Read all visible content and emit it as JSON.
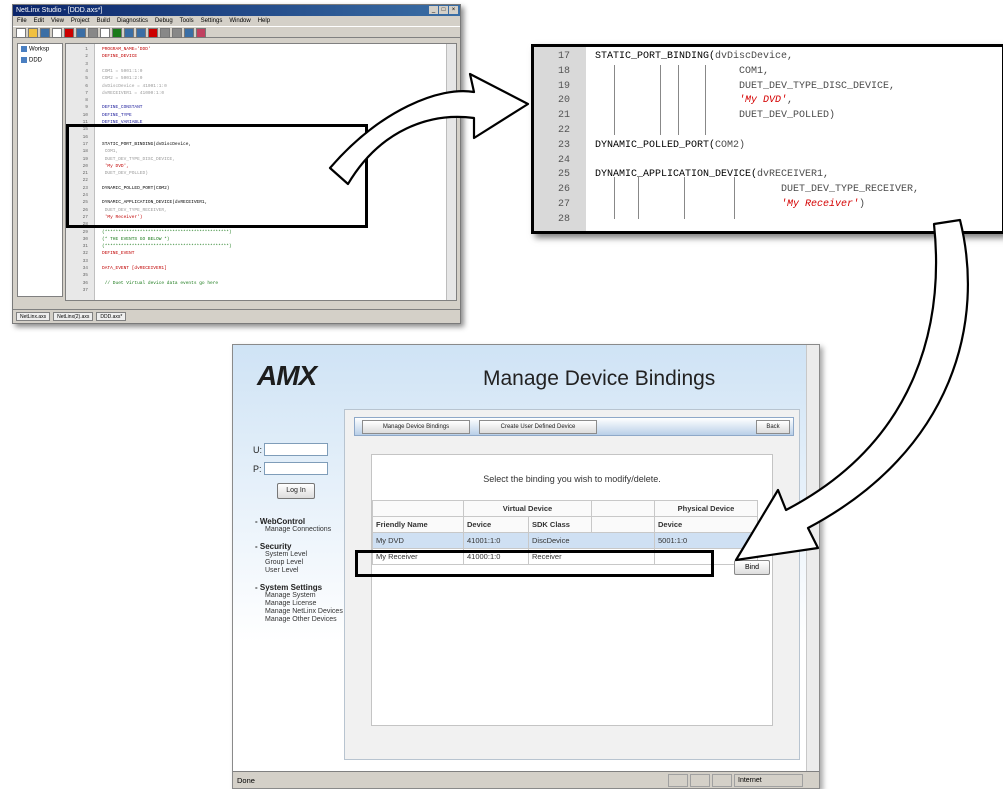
{
  "studio": {
    "title": "NetLinx Studio - [DDD.axs*]",
    "menu": [
      "File",
      "Edit",
      "View",
      "Project",
      "Build",
      "Diagnostics",
      "Debug",
      "Tools",
      "Settings",
      "Window",
      "Help"
    ],
    "tree": [
      "Worksp",
      "DDD"
    ],
    "tabs": [
      "NetLinx.axs",
      "NetLinx(2).axs",
      "DDD.axs*"
    ],
    "code": [
      {
        "n": "1",
        "t": "PROGRAM_NAME='DDD'",
        "c": "#c00000"
      },
      {
        "n": "2",
        "t": "DEFINE_DEVICE",
        "c": "#c00000"
      },
      {
        "n": "3",
        "t": "",
        "c": "#000"
      },
      {
        "n": "4",
        "t": "COM1 = 5001:1:0",
        "c": "#9a9a9a"
      },
      {
        "n": "5",
        "t": "COM2 = 5001:2:0",
        "c": "#9a9a9a"
      },
      {
        "n": "6",
        "t": "dvDiscDevice = 41001:1:0",
        "c": "#9a9a9a"
      },
      {
        "n": "7",
        "t": "dvRECEIVER1 = 41000:1:0",
        "c": "#9a9a9a"
      },
      {
        "n": "8",
        "t": "",
        "c": "#000"
      },
      {
        "n": "9",
        "t": "DEFINE_CONSTANT",
        "c": "#1a1a9a"
      },
      {
        "n": "10",
        "t": "DEFINE_TYPE",
        "c": "#1a1a9a"
      },
      {
        "n": "11",
        "t": "DEFINE_VARIABLE",
        "c": "#1a1a9a"
      },
      {
        "n": "15",
        "t": "",
        "c": "#000"
      },
      {
        "n": "16",
        "t": "",
        "c": "#000"
      },
      {
        "n": "17",
        "t": "STATIC_PORT_BINDING(dvDiscDevice,",
        "c": "#000"
      },
      {
        "n": "18",
        "t": "                 COM1,",
        "c": "#9a9a9a"
      },
      {
        "n": "19",
        "t": "                 DUET_DEV_TYPE_DISC_DEVICE,",
        "c": "#9a9a9a"
      },
      {
        "n": "20",
        "t": "                 'My DVD',",
        "c": "#c00000"
      },
      {
        "n": "21",
        "t": "                 DUET_DEV_POLLED)",
        "c": "#9a9a9a"
      },
      {
        "n": "22",
        "t": "",
        "c": "#000"
      },
      {
        "n": "23",
        "t": "DYNAMIC_POLLED_PORT(COM2)",
        "c": "#000"
      },
      {
        "n": "24",
        "t": "",
        "c": "#000"
      },
      {
        "n": "25",
        "t": "DYNAMIC_APPLICATION_DEVICE(dvRECEIVER1,",
        "c": "#000"
      },
      {
        "n": "26",
        "t": "                       DUET_DEV_TYPE_RECEIVER,",
        "c": "#9a9a9a"
      },
      {
        "n": "27",
        "t": "                       'My Receiver')",
        "c": "#c00000"
      },
      {
        "n": "28",
        "t": "",
        "c": "#000"
      },
      {
        "n": "29",
        "t": "(**********************************************)",
        "c": "#1a7a1a"
      },
      {
        "n": "30",
        "t": "(*           THE EVENTS GO BELOW             *)",
        "c": "#1a7a1a"
      },
      {
        "n": "31",
        "t": "(**********************************************)",
        "c": "#1a7a1a"
      },
      {
        "n": "32",
        "t": "DEFINE_EVENT",
        "c": "#c00000"
      },
      {
        "n": "33",
        "t": "",
        "c": "#000"
      },
      {
        "n": "34",
        "t": "DATA_EVENT [dvRECEIVER1]",
        "c": "#c00000"
      },
      {
        "n": "35",
        "t": "",
        "c": "#000"
      },
      {
        "n": "36",
        "t": "     // Duet Virtual device data events go here",
        "c": "#1a7a1a"
      },
      {
        "n": "37",
        "t": "",
        "c": "#000"
      }
    ]
  },
  "zoom": {
    "lines": [
      {
        "n": "17",
        "t": "STATIC_PORT_BINDING(",
        "rest": "dvDiscDevice,",
        "cls": "kw"
      },
      {
        "n": "18",
        "t": "                        COM1,",
        "rest": "",
        "cls": "dim"
      },
      {
        "n": "19",
        "t": "                        DUET_DEV_TYPE_DISC_DEVICE,",
        "rest": "",
        "cls": "dim"
      },
      {
        "n": "20",
        "t": "                        'My DVD'",
        "rest": ",",
        "cls": "str"
      },
      {
        "n": "21",
        "t": "                        DUET_DEV_POLLED)",
        "rest": "",
        "cls": "dim"
      },
      {
        "n": "22",
        "t": "",
        "rest": "",
        "cls": "dim"
      },
      {
        "n": "23",
        "t": "DYNAMIC_POLLED_PORT(",
        "rest": "COM2)",
        "cls": "kw"
      },
      {
        "n": "24",
        "t": "",
        "rest": "",
        "cls": "dim"
      },
      {
        "n": "25",
        "t": "DYNAMIC_APPLICATION_DEVICE(",
        "rest": "dvRECEIVER1,",
        "cls": "kw"
      },
      {
        "n": "26",
        "t": "                               DUET_DEV_TYPE_RECEIVER,",
        "rest": "",
        "cls": "dim"
      },
      {
        "n": "27",
        "t": "                               'My Receiver'",
        "rest": ")",
        "cls": "str"
      },
      {
        "n": "28",
        "t": "",
        "rest": "",
        "cls": "dim"
      }
    ]
  },
  "browser": {
    "logo": "AMX",
    "page_title": "Manage Device Bindings",
    "login": {
      "user_label": "U:",
      "pass_label": "P:",
      "button": "Log In"
    },
    "nav": [
      {
        "section": "- WebControl",
        "items": [
          "Manage Connections"
        ]
      },
      {
        "section": "- Security",
        "items": [
          "System Level",
          "Group Level",
          "User Level"
        ]
      },
      {
        "section": "- System Settings",
        "items": [
          "Manage System",
          "Manage License",
          "Manage NetLinx Devices",
          "Manage Other Devices"
        ]
      }
    ],
    "tabs": {
      "manage": "Manage Device Bindings",
      "create": "Create User Defined Device",
      "back": "Back"
    },
    "instruction": "Select the binding you wish to modify/delete.",
    "table": {
      "group_virtual": "Virtual Device",
      "group_physical": "Physical Device",
      "headers": [
        "Friendly Name",
        "Device",
        "SDK Class",
        "Device"
      ],
      "rows": [
        [
          "My DVD",
          "41001:1:0",
          "DiscDevice",
          "5001:1:0"
        ],
        [
          "My Receiver",
          "41000:1:0",
          "Receiver",
          ""
        ]
      ]
    },
    "bind_button": "Bind",
    "status_done": "Done",
    "zone": "Internet"
  },
  "colors": {
    "accent": "#0a246a",
    "selection": "#cfe0f3",
    "string": "#d40000"
  }
}
